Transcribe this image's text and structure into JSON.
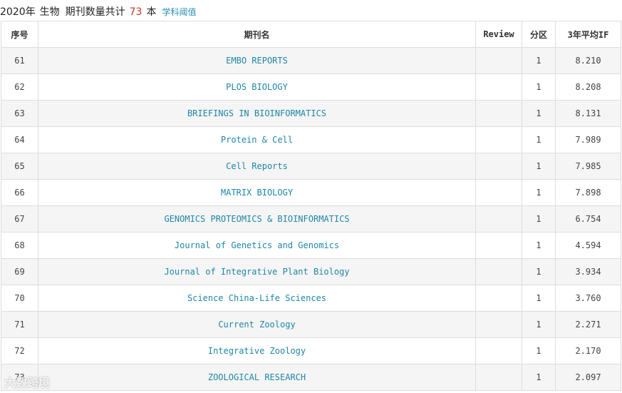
{
  "header": {
    "year": "2020年",
    "field": "生物",
    "text": "期刊数量共计",
    "count": "73",
    "unit": "本",
    "link": "学科阈值"
  },
  "columns": {
    "index": "序号",
    "journal": "期刊名",
    "review": "Review",
    "zone": "分区",
    "if": "3年平均IF"
  },
  "rows": [
    {
      "index": "61",
      "journal": "EMBO REPORTS",
      "review": "",
      "zone": "1",
      "if": "8.210"
    },
    {
      "index": "62",
      "journal": "PLOS BIOLOGY",
      "review": "",
      "zone": "1",
      "if": "8.208"
    },
    {
      "index": "63",
      "journal": "BRIEFINGS IN BIOINFORMATICS",
      "review": "",
      "zone": "1",
      "if": "8.131"
    },
    {
      "index": "64",
      "journal": "Protein & Cell",
      "review": "",
      "zone": "1",
      "if": "7.989"
    },
    {
      "index": "65",
      "journal": "Cell Reports",
      "review": "",
      "zone": "1",
      "if": "7.985"
    },
    {
      "index": "66",
      "journal": "MATRIX BIOLOGY",
      "review": "",
      "zone": "1",
      "if": "7.898"
    },
    {
      "index": "67",
      "journal": "GENOMICS PROTEOMICS & BIOINFORMATICS",
      "review": "",
      "zone": "1",
      "if": "6.754"
    },
    {
      "index": "68",
      "journal": "Journal of Genetics and Genomics",
      "review": "",
      "zone": "1",
      "if": "4.594"
    },
    {
      "index": "69",
      "journal": "Journal of Integrative Plant Biology",
      "review": "",
      "zone": "1",
      "if": "3.934"
    },
    {
      "index": "70",
      "journal": "Science China-Life Sciences",
      "review": "",
      "zone": "1",
      "if": "3.760"
    },
    {
      "index": "71",
      "journal": "Current Zoology",
      "review": "",
      "zone": "1",
      "if": "2.271"
    },
    {
      "index": "72",
      "journal": "Integrative Zoology",
      "review": "",
      "zone": "1",
      "if": "2.170"
    },
    {
      "index": "73",
      "journal": "ZOOLOGICAL RESEARCH",
      "review": "",
      "zone": "1",
      "if": "2.097"
    }
  ],
  "watermark": "大数跨境"
}
